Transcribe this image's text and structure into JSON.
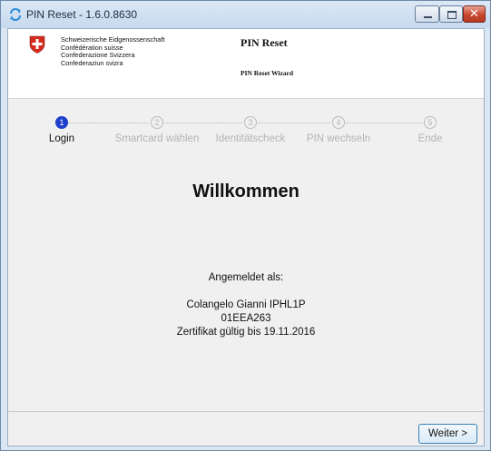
{
  "window": {
    "title": "PIN Reset - 1.6.0.8630",
    "close_glyph": "✕"
  },
  "header": {
    "confederation": [
      "Schweizerische Eidgenossenschaft",
      "Confédération suisse",
      "Confederazione Svizzera",
      "Confederaziun svizra"
    ],
    "title": "PIN Reset",
    "subtitle": "PIN Reset Wizard"
  },
  "steps": [
    {
      "number": "1",
      "label": "Login",
      "active": true
    },
    {
      "number": "2",
      "label": "Smartcard wählen",
      "active": false
    },
    {
      "number": "3",
      "label": "Identitätscheck",
      "active": false
    },
    {
      "number": "4",
      "label": "PIN wechseln",
      "active": false
    },
    {
      "number": "5",
      "label": "Ende",
      "active": false
    }
  ],
  "main": {
    "welcome": "Willkommen",
    "logged_in_label": "Angemeldet als:",
    "user_name": "Colangelo Gianni IPHL1P",
    "user_id": "01EEA263",
    "certificate": "Zertifikat gültig bis 19.11.2016"
  },
  "footer": {
    "next_label": "Weiter >"
  },
  "colors": {
    "active_step": "#1f3fcc",
    "swiss_red": "#d52b1e"
  }
}
